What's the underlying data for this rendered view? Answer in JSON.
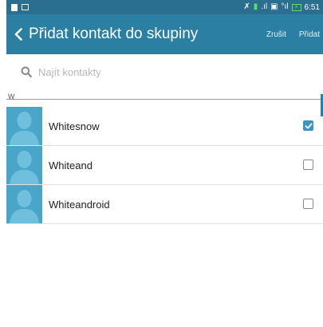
{
  "status_bar": {
    "time": "6:51",
    "battery_level": "50",
    "icons": [
      "notification-icon",
      "image-icon",
      "mute-icon",
      "sim-icon",
      "signal-icon",
      "sim2-icon",
      "battery-icon"
    ]
  },
  "action_bar": {
    "title": "Přidat kontakt do skupiny",
    "cancel_label": "Zrušit",
    "add_label": "Přidat"
  },
  "search": {
    "placeholder": "Najít kontakty",
    "value": ""
  },
  "section": {
    "letter": "W"
  },
  "contacts": [
    {
      "name": "Whitesnow",
      "checked": true
    },
    {
      "name": "Whiteand",
      "checked": false
    },
    {
      "name": "Whiteandroid",
      "checked": false
    }
  ],
  "colors": {
    "status_bar": "#2a6f8f",
    "action_bar": "#2a7fa3",
    "avatar_bg": "#4aa6c8",
    "check_accent": "#3b95c4"
  }
}
